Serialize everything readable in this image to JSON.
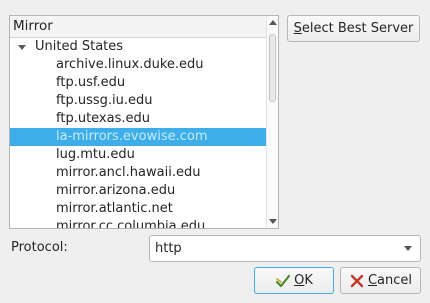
{
  "mirror_list": {
    "column_header": "Mirror",
    "group": "United States",
    "items": [
      "archive.linux.duke.edu",
      "ftp.usf.edu",
      "ftp.ussg.iu.edu",
      "ftp.utexas.edu",
      "la-mirrors.evowise.com",
      "lug.mtu.edu",
      "mirror.ancl.hawaii.edu",
      "mirror.arizona.edu",
      "mirror.atlantic.net",
      "mirror.cc.columbia.edu"
    ],
    "selected": "la-mirrors.evowise.com"
  },
  "select_best_server": {
    "mnemonic": "S",
    "rest": "elect Best Server"
  },
  "protocol": {
    "label": "Protocol:",
    "value": "http"
  },
  "ok_button": {
    "mnemonic": "O",
    "rest": "K"
  },
  "cancel_button": {
    "mnemonic": "C",
    "rest": "ancel"
  },
  "colors": {
    "selection": "#3daee9",
    "background": "#efefef"
  },
  "icons": {
    "ok": "ok-check-icon",
    "cancel": "cancel-x-icon",
    "expander": "chevron-down-icon"
  }
}
